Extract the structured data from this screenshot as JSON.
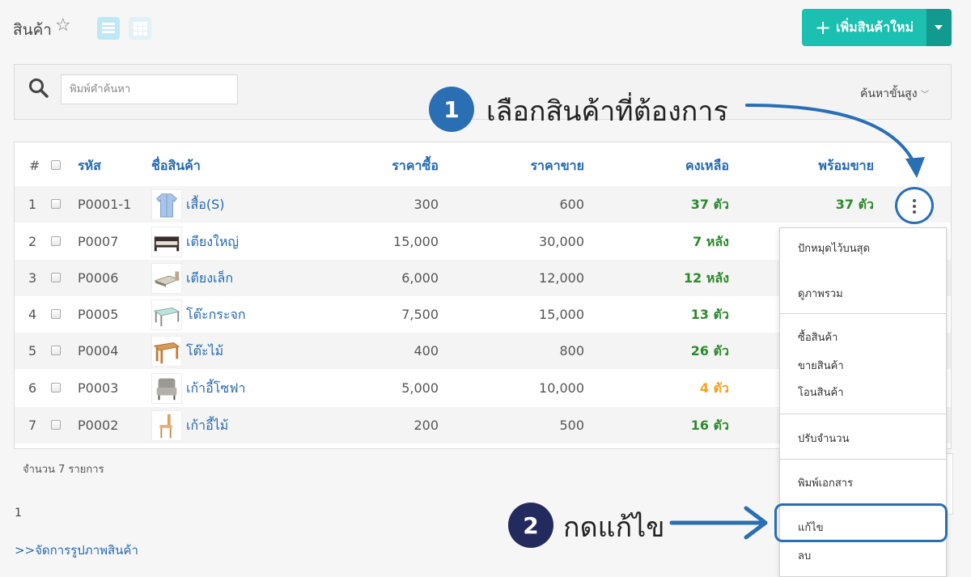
{
  "header": {
    "title": "สินค้า",
    "add_button_label": "เพิ่มสินค้าใหม่"
  },
  "search": {
    "placeholder": "พิมพ์คำค้นหา",
    "advanced_label": "ค้นหาขั้นสูง"
  },
  "callouts": {
    "step1_number": "1",
    "step1_text": "เลือกสินค้าที่ต้องการ",
    "step2_number": "2",
    "step2_text": "กดแก้ไข"
  },
  "table": {
    "headers": {
      "index": "#",
      "code": "รหัส",
      "name": "ชื่อสินค้า",
      "buy_price": "ราคาซื้อ",
      "sell_price": "ราคาขาย",
      "remaining": "คงเหลือ",
      "available": "พร้อมขาย"
    },
    "rows": [
      {
        "index": "1",
        "code": "P0001-1",
        "name": "เสื้อ(S)",
        "buy": "300",
        "sell": "600",
        "remaining": "37 ตัว",
        "available": "37 ตัว"
      },
      {
        "index": "2",
        "code": "P0007",
        "name": "เตียงใหญ่",
        "buy": "15,000",
        "sell": "30,000",
        "remaining": "7 หลัง"
      },
      {
        "index": "3",
        "code": "P0006",
        "name": "เตียงเล็ก",
        "buy": "6,000",
        "sell": "12,000",
        "remaining": "12 หลัง"
      },
      {
        "index": "4",
        "code": "P0005",
        "name": "โต๊ะกระจก",
        "buy": "7,500",
        "sell": "15,000",
        "remaining": "13 ตัว"
      },
      {
        "index": "5",
        "code": "P0004",
        "name": "โต๊ะไม้",
        "buy": "400",
        "sell": "800",
        "remaining": "26 ตัว"
      },
      {
        "index": "6",
        "code": "P0003",
        "name": "เก้าอี้โซฟา",
        "buy": "5,000",
        "sell": "10,000",
        "remaining": "4 ตัว"
      },
      {
        "index": "7",
        "code": "P0002",
        "name": "เก้าอี้ไม้",
        "buy": "200",
        "sell": "500",
        "remaining": "16 ตัว"
      }
    ]
  },
  "footer": {
    "count_text": "จำนวน 7 รายการ",
    "page_number": "1",
    "manage_images_link": ">>จัดการรูปภาพสินค้า"
  },
  "menu": {
    "pin_top": "ปักหมุดไว้บนสุด",
    "view_overview": "ดูภาพรวม",
    "buy": "ซื้อสินค้า",
    "sell": "ขายสินค้า",
    "transfer": "โอนสินค้า",
    "adjust_qty": "ปรับจำนวน",
    "print_doc": "พิมพ์เอกสาร",
    "edit": "แก้ไข",
    "delete": "ลบ"
  },
  "colors": {
    "accent_teal": "#1bc0b0",
    "link_blue": "#2669b0",
    "stock_green": "#2c8a2c",
    "stock_low_orange": "#f5a21b",
    "callout_blue": "#2a6eb4",
    "callout_navy": "#232b5e"
  },
  "icons": [
    "star-icon",
    "list-view-icon",
    "grid-view-icon",
    "plus-icon",
    "caret-down-icon",
    "search-icon",
    "chevron-down-icon",
    "kebab-menu-icon",
    "arrow-icon"
  ]
}
